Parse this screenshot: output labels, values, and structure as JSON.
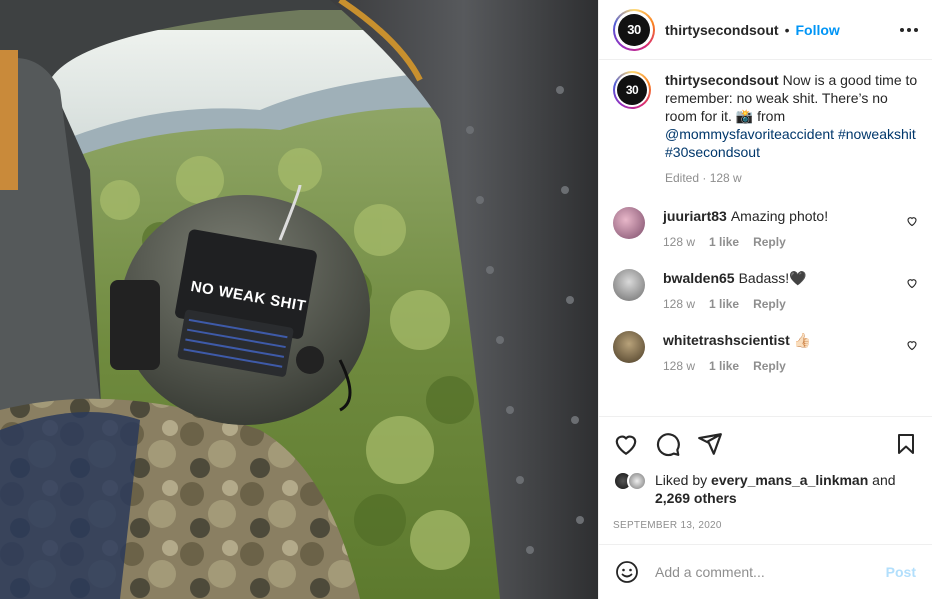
{
  "post": {
    "username": "thirtysecondsout",
    "separator": "•",
    "follow_label": "Follow",
    "avatar_logo_main": "30",
    "avatar_logo_small": "SEC OUT",
    "photo": {
      "helmet_sticker_text": "NO WEAK SHIT"
    }
  },
  "caption": {
    "username": "thirtysecondsout",
    "text": "Now is a good time to remember: no weak shit. There’s no room for it. 📸 from",
    "mention": "@mommysfavoriteaccident",
    "hashtags": "#noweakshit #30secondsout",
    "edited": "Edited · 128 w"
  },
  "comments": [
    {
      "username": "juuriart83",
      "text": "Amazing photo!",
      "age": "128 w",
      "likes": "1 like",
      "reply": "Reply"
    },
    {
      "username": "bwalden65",
      "text": "Badass!🖤",
      "age": "128 w",
      "likes": "1 like",
      "reply": "Reply"
    },
    {
      "username": "whitetrashscientist",
      "text": "👍🏻",
      "age": "128 w",
      "likes": "1 like",
      "reply": "Reply"
    }
  ],
  "likes": {
    "prefix": "Liked by",
    "user": "every_mans_a_linkman",
    "joiner": "and",
    "others": "2,269 others"
  },
  "date": "SEPTEMBER 13, 2020",
  "add_comment": {
    "placeholder": "Add a comment...",
    "post_label": "Post"
  },
  "colors": {
    "accent": "#0095f6",
    "post_disabled": "#b2dffc",
    "muted": "#8e8e8e"
  }
}
